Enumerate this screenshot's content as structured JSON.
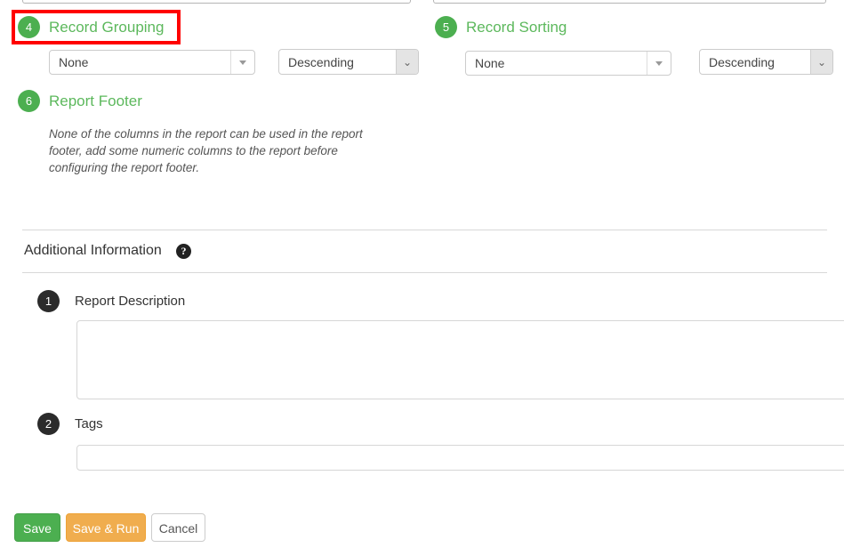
{
  "top_partial_inputs": [
    {
      "name": "partial-input-left"
    },
    {
      "name": "partial-input-right"
    }
  ],
  "sections": {
    "record_grouping": {
      "step": "4",
      "title": "Record Grouping",
      "highlighted": true,
      "column_select": {
        "value": "None",
        "arrow_icon": "triangle-down-icon"
      },
      "direction_select": {
        "value": "Descending",
        "arrow_icon": "chevron-down-icon"
      }
    },
    "record_sorting": {
      "step": "5",
      "title": "Record Sorting",
      "column_select": {
        "value": "None",
        "arrow_icon": "triangle-down-icon"
      },
      "direction_select": {
        "value": "Descending",
        "arrow_icon": "chevron-down-icon"
      }
    },
    "report_footer": {
      "step": "6",
      "title": "Report Footer",
      "note": "None of the columns in the report can be used in the report footer, add some numeric columns to the report before configuring the report footer."
    }
  },
  "additional_information": {
    "heading": "Additional Information",
    "help_icon": "question-mark-circle-icon",
    "help_glyph": "?",
    "fields": [
      {
        "step": "1",
        "label": "Report Description",
        "value": "",
        "placeholder": ""
      },
      {
        "step": "2",
        "label": "Tags",
        "value": "",
        "placeholder": ""
      }
    ]
  },
  "footer_actions": {
    "save": "Save",
    "save_and_run": "Save & Run",
    "cancel": "Cancel"
  },
  "colors": {
    "step_green": "#4caf50",
    "step_dark": "#2b2b2b",
    "title_green": "#5cb85c",
    "highlight_red": "#ff0000",
    "save_green": "#4caf50",
    "save_run_orange": "#f0ad4e"
  }
}
